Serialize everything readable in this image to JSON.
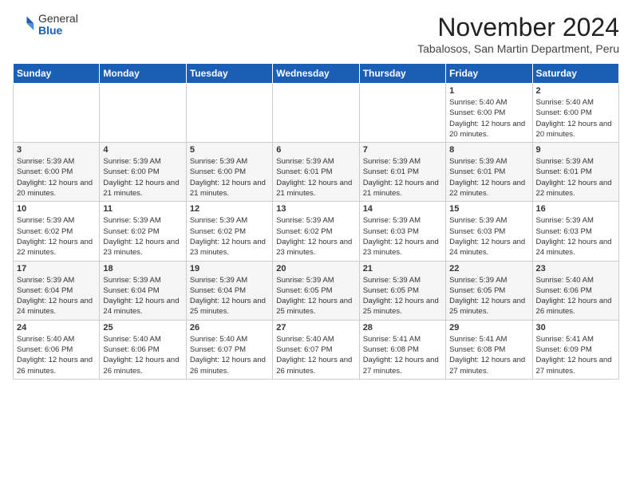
{
  "header": {
    "logo_general": "General",
    "logo_blue": "Blue",
    "month_title": "November 2024",
    "location": "Tabalosos, San Martin Department, Peru"
  },
  "calendar": {
    "days_of_week": [
      "Sunday",
      "Monday",
      "Tuesday",
      "Wednesday",
      "Thursday",
      "Friday",
      "Saturday"
    ],
    "weeks": [
      [
        {
          "day": "",
          "info": ""
        },
        {
          "day": "",
          "info": ""
        },
        {
          "day": "",
          "info": ""
        },
        {
          "day": "",
          "info": ""
        },
        {
          "day": "",
          "info": ""
        },
        {
          "day": "1",
          "info": "Sunrise: 5:40 AM\nSunset: 6:00 PM\nDaylight: 12 hours and 20 minutes."
        },
        {
          "day": "2",
          "info": "Sunrise: 5:40 AM\nSunset: 6:00 PM\nDaylight: 12 hours and 20 minutes."
        }
      ],
      [
        {
          "day": "3",
          "info": "Sunrise: 5:39 AM\nSunset: 6:00 PM\nDaylight: 12 hours and 20 minutes."
        },
        {
          "day": "4",
          "info": "Sunrise: 5:39 AM\nSunset: 6:00 PM\nDaylight: 12 hours and 21 minutes."
        },
        {
          "day": "5",
          "info": "Sunrise: 5:39 AM\nSunset: 6:00 PM\nDaylight: 12 hours and 21 minutes."
        },
        {
          "day": "6",
          "info": "Sunrise: 5:39 AM\nSunset: 6:01 PM\nDaylight: 12 hours and 21 minutes."
        },
        {
          "day": "7",
          "info": "Sunrise: 5:39 AM\nSunset: 6:01 PM\nDaylight: 12 hours and 21 minutes."
        },
        {
          "day": "8",
          "info": "Sunrise: 5:39 AM\nSunset: 6:01 PM\nDaylight: 12 hours and 22 minutes."
        },
        {
          "day": "9",
          "info": "Sunrise: 5:39 AM\nSunset: 6:01 PM\nDaylight: 12 hours and 22 minutes."
        }
      ],
      [
        {
          "day": "10",
          "info": "Sunrise: 5:39 AM\nSunset: 6:02 PM\nDaylight: 12 hours and 22 minutes."
        },
        {
          "day": "11",
          "info": "Sunrise: 5:39 AM\nSunset: 6:02 PM\nDaylight: 12 hours and 23 minutes."
        },
        {
          "day": "12",
          "info": "Sunrise: 5:39 AM\nSunset: 6:02 PM\nDaylight: 12 hours and 23 minutes."
        },
        {
          "day": "13",
          "info": "Sunrise: 5:39 AM\nSunset: 6:02 PM\nDaylight: 12 hours and 23 minutes."
        },
        {
          "day": "14",
          "info": "Sunrise: 5:39 AM\nSunset: 6:03 PM\nDaylight: 12 hours and 23 minutes."
        },
        {
          "day": "15",
          "info": "Sunrise: 5:39 AM\nSunset: 6:03 PM\nDaylight: 12 hours and 24 minutes."
        },
        {
          "day": "16",
          "info": "Sunrise: 5:39 AM\nSunset: 6:03 PM\nDaylight: 12 hours and 24 minutes."
        }
      ],
      [
        {
          "day": "17",
          "info": "Sunrise: 5:39 AM\nSunset: 6:04 PM\nDaylight: 12 hours and 24 minutes."
        },
        {
          "day": "18",
          "info": "Sunrise: 5:39 AM\nSunset: 6:04 PM\nDaylight: 12 hours and 24 minutes."
        },
        {
          "day": "19",
          "info": "Sunrise: 5:39 AM\nSunset: 6:04 PM\nDaylight: 12 hours and 25 minutes."
        },
        {
          "day": "20",
          "info": "Sunrise: 5:39 AM\nSunset: 6:05 PM\nDaylight: 12 hours and 25 minutes."
        },
        {
          "day": "21",
          "info": "Sunrise: 5:39 AM\nSunset: 6:05 PM\nDaylight: 12 hours and 25 minutes."
        },
        {
          "day": "22",
          "info": "Sunrise: 5:39 AM\nSunset: 6:05 PM\nDaylight: 12 hours and 25 minutes."
        },
        {
          "day": "23",
          "info": "Sunrise: 5:40 AM\nSunset: 6:06 PM\nDaylight: 12 hours and 26 minutes."
        }
      ],
      [
        {
          "day": "24",
          "info": "Sunrise: 5:40 AM\nSunset: 6:06 PM\nDaylight: 12 hours and 26 minutes."
        },
        {
          "day": "25",
          "info": "Sunrise: 5:40 AM\nSunset: 6:06 PM\nDaylight: 12 hours and 26 minutes."
        },
        {
          "day": "26",
          "info": "Sunrise: 5:40 AM\nSunset: 6:07 PM\nDaylight: 12 hours and 26 minutes."
        },
        {
          "day": "27",
          "info": "Sunrise: 5:40 AM\nSunset: 6:07 PM\nDaylight: 12 hours and 26 minutes."
        },
        {
          "day": "28",
          "info": "Sunrise: 5:41 AM\nSunset: 6:08 PM\nDaylight: 12 hours and 27 minutes."
        },
        {
          "day": "29",
          "info": "Sunrise: 5:41 AM\nSunset: 6:08 PM\nDaylight: 12 hours and 27 minutes."
        },
        {
          "day": "30",
          "info": "Sunrise: 5:41 AM\nSunset: 6:09 PM\nDaylight: 12 hours and 27 minutes."
        }
      ]
    ]
  }
}
